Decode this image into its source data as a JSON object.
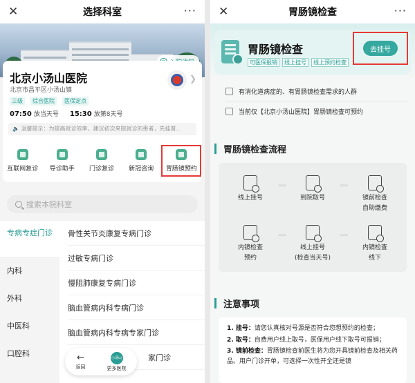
{
  "left": {
    "nav": {
      "close": "✕",
      "title": "选择科室",
      "more": "···"
    },
    "banner": {
      "notice": "入院须知",
      "notice_icon": "≡"
    },
    "hospital": {
      "name": "北京小汤山医院",
      "address": "北京市昌平区小汤山镇",
      "tags": [
        "三级",
        "综合医院",
        "医保定点"
      ],
      "times": [
        {
          "time": "07:50",
          "text": "放当天号"
        },
        {
          "time": "15:30",
          "text": "放第8天号"
        }
      ],
      "tip": "🔈 温馨提示：为提高就诊效率，建议初次来院就诊的患者，先挂普..."
    },
    "quick": [
      {
        "label": "互联网复诊"
      },
      {
        "label": "导诊助手"
      },
      {
        "label": "门诊复诊"
      },
      {
        "label": "新冠咨询"
      },
      {
        "label": "胃肠镜预约"
      }
    ],
    "search": {
      "placeholder": "搜索本院科室"
    },
    "categories": [
      "专病专症门诊",
      "内科",
      "外科",
      "中医科",
      "口腔科"
    ],
    "departments": [
      "骨性关节炎康复专病门诊",
      "过敏专病门诊",
      "慢阻肺康复专病门诊",
      "脑血管病内科专病门诊",
      "脑血管病内科专病专家门诊",
      "家门诊"
    ],
    "floatbar": {
      "back_icon": "←",
      "back_label": "返回",
      "more_badge": "小汤山",
      "more_label": "更多医院"
    }
  },
  "right": {
    "nav": {
      "close": "✕",
      "title": "胃肠镜检查",
      "more": "···"
    },
    "service": {
      "title": "胃肠镜检查",
      "tags": [
        "可医保报销",
        "线上挂号",
        "线上预约检查"
      ],
      "register": "去挂号"
    },
    "info": [
      "有消化道病症的、有胃肠镜检查需求的人群",
      "当前仅【北京小汤山医院】胃肠镜检查可预约"
    ],
    "flow_title": "胃肠镜检查流程",
    "flow_arrow": "»»»",
    "flow": [
      {
        "line1": "线上挂号",
        "line2": ""
      },
      {
        "line1": "到院取号",
        "line2": ""
      },
      {
        "line1": "镜前检查",
        "line2": "自助缴费"
      },
      {
        "line1": "内镜检查",
        "line2": "预约"
      },
      {
        "line1": "线上挂号",
        "line2": "(检查当天号)"
      },
      {
        "line1": "内镜检查",
        "line2": "线下"
      }
    ],
    "notes_title": "注意事项",
    "notes": [
      {
        "head": "1. 挂号：",
        "body": "请您认真核对号源是否符合您想预约的检查；"
      },
      {
        "head": "2. 取号：",
        "body": "自费用户线上取号，医保用户线下取号可报销；"
      },
      {
        "head": "3. 镜前检查：",
        "body": "胃肠镜检查前医生将为您开具镜前检查及相关药品。用户门诊开单，可选择一次性开全还是镜"
      }
    ]
  },
  "colors": {
    "accent": "#2a9d94",
    "highlight": "#e53935"
  }
}
